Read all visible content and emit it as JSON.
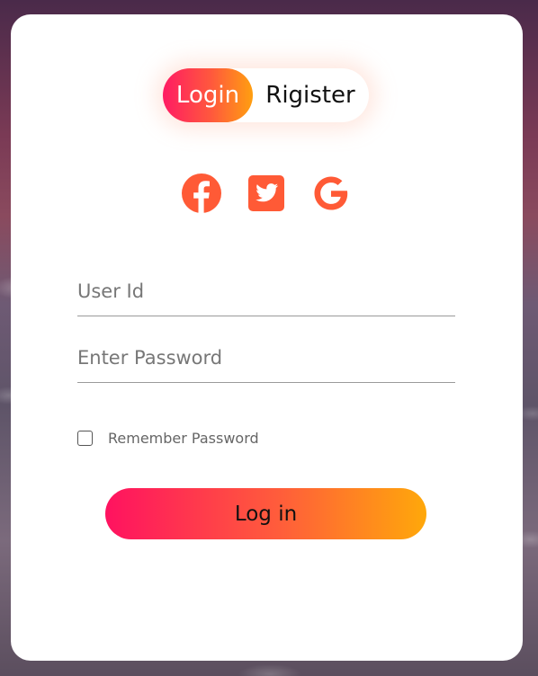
{
  "toggle": {
    "login_label": "Login",
    "register_label": "Rigister"
  },
  "socials": [
    {
      "icon": "facebook-icon",
      "color": "#ff5a36"
    },
    {
      "icon": "twitter-icon",
      "color": "#ff5a36"
    },
    {
      "icon": "google-icon",
      "color": "#ff5a36"
    }
  ],
  "form": {
    "user_placeholder": "User Id",
    "user_value": "",
    "password_placeholder": "Enter Password",
    "password_value": "",
    "remember_label": "Remember Password",
    "remember_checked": false,
    "submit_label": "Log in"
  },
  "colors": {
    "accent_start": "#ff1260",
    "accent_end": "#ffa80a",
    "icon": "#ff5a36"
  }
}
